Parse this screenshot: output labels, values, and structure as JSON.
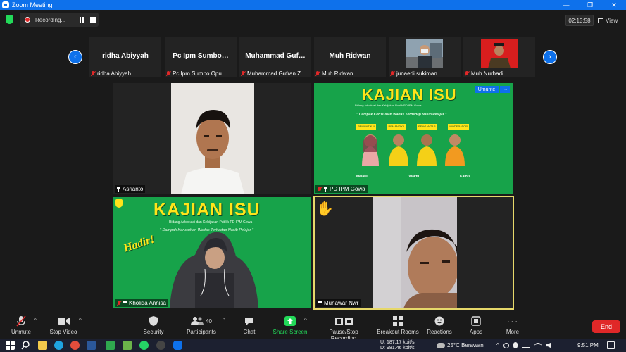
{
  "window": {
    "title": "Zoom Meeting",
    "controls": [
      "—",
      "❐",
      "✕"
    ]
  },
  "topbar": {
    "recording_label": "Recording...",
    "timer": "02:13:58",
    "view_label": "View"
  },
  "strip": {
    "prev_glyph": "‹",
    "next_glyph": "›",
    "thumbs": [
      {
        "name": "ridha Abiyyah",
        "label": "ridha Abiyyah",
        "has_video": false
      },
      {
        "name": "Pc Ipm Sumbo…",
        "label": "Pc Ipm Sumbo Opu",
        "has_video": false
      },
      {
        "name": "Muhammad Guf…",
        "label": "Muhammad Gufran Z…",
        "has_video": false
      },
      {
        "name": "Muh Ridwan",
        "label": "Muh Ridwan",
        "has_video": false
      },
      {
        "name": "",
        "label": "junaedi sukiman",
        "has_video": true
      },
      {
        "name": "",
        "label": "Muh Nurhadi",
        "has_video": true
      }
    ]
  },
  "tiles": {
    "asrianto": {
      "label": "Asrianto"
    },
    "pd_ipm": {
      "label": "PD IPM Gowa",
      "poster_title": "KAJIAN ISU",
      "poster_sub": "Bidang Advokasi dan Kebijakan Publik PD IPM Gowa",
      "poster_theme": "\" Dampak Kerusuhan Wadas Terhadap Nasib Pelajar \"",
      "roles": [
        "MODERATOR",
        "PENGANTAR",
        "PEMANTIK I",
        "PEMANTIK II"
      ],
      "umunte_label": "Umunte",
      "info": [
        "Melalui",
        "Waktu",
        "Kamis"
      ]
    },
    "kholida": {
      "label": "Kholida Annisa",
      "poster_title": "KAJIAN ISU",
      "poster_sub": "Bidang Advokasi dan Kebijakan Publik PD IPM Gowa",
      "poster_theme": "\" Dampak Kerusuhan Wadas Terhadap Nasib Pelajar \"",
      "hadir": "Hadir!"
    },
    "munawar": {
      "label": "Munawar Nwr",
      "reaction": "✋"
    }
  },
  "toolbar": {
    "unmute": "Unmute",
    "stop_video": "Stop Video",
    "security": "Security",
    "participants": "Participants",
    "participants_count": "40",
    "chat": "Chat",
    "share_screen": "Share Screen",
    "record": "Pause/Stop Recording",
    "breakout": "Breakout Rooms",
    "reactions": "Reactions",
    "apps": "Apps",
    "more": "More",
    "end": "End"
  },
  "taskbar": {
    "net_up": "187.17 kbit/s",
    "net_down": "981.46 kbit/s",
    "net_u_label": "U:",
    "net_d_label": "D:",
    "weather": "25°C  Berawan",
    "time": "9:51 PM"
  },
  "colors": {
    "zoom_blue": "#0e71eb",
    "end_red": "#e02828",
    "share_green": "#23d959",
    "poster_green": "#17a34a",
    "poster_yellow": "#ffe41a"
  }
}
